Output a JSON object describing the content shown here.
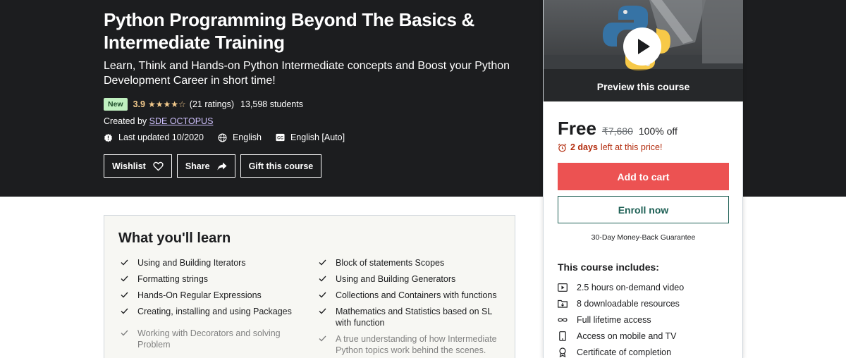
{
  "course": {
    "title": "Python Programming Beyond The Basics & Intermediate Training",
    "subtitle": "Learn, Think and Hands-on Python Intermediate concepts and Boost your Python Development Career in short time!",
    "badge": "New",
    "rating": "3.9",
    "rating_stars": 3.9,
    "ratings_count": "(21 ratings)",
    "students": "13,598 students",
    "created_by_label": "Created by",
    "author": "SDE OCTOPUS",
    "last_updated": "Last updated 10/2020",
    "language": "English",
    "captions": "English [Auto]"
  },
  "actions": {
    "wishlist": "Wishlist",
    "share": "Share",
    "gift": "Gift this course"
  },
  "sidebar": {
    "preview_label": "Preview this course",
    "price": "Free",
    "original_price": "₹7,680",
    "discount": "100% off",
    "timer_bold": "2 days",
    "timer_rest": "left at this price!",
    "add_to_cart": "Add to cart",
    "enroll": "Enroll now",
    "guarantee": "30-Day Money-Back Guarantee",
    "includes_title": "This course includes:",
    "includes": [
      {
        "icon": "video-icon",
        "label": "2.5 hours on-demand video"
      },
      {
        "icon": "folder-icon",
        "label": "8 downloadable resources"
      },
      {
        "icon": "infinity-icon",
        "label": "Full lifetime access"
      },
      {
        "icon": "mobile-icon",
        "label": "Access on mobile and TV"
      },
      {
        "icon": "certificate-icon",
        "label": "Certificate of completion"
      }
    ]
  },
  "learn": {
    "title": "What you'll learn",
    "left": [
      "Using and Building Iterators",
      "Formatting strings",
      "Hands-On Regular Expressions",
      "Creating, installing and using Packages",
      "Working with Decorators and solving Problem"
    ],
    "right": [
      "Block of statements Scopes",
      "Using and Building Generators",
      "Collections and Containers with functions",
      "Mathematics and Statistics based on SL with function",
      "A true understanding of how Intermediate Python topics work behind the scenes."
    ]
  },
  "colors": {
    "hero_bg": "#1c1d1f",
    "rating_gold": "#f3ca8c",
    "cart_red": "#ec5252",
    "enroll_teal": "#1e6055",
    "timer_red": "#b32d0f",
    "author_link": "#cec0fc"
  }
}
